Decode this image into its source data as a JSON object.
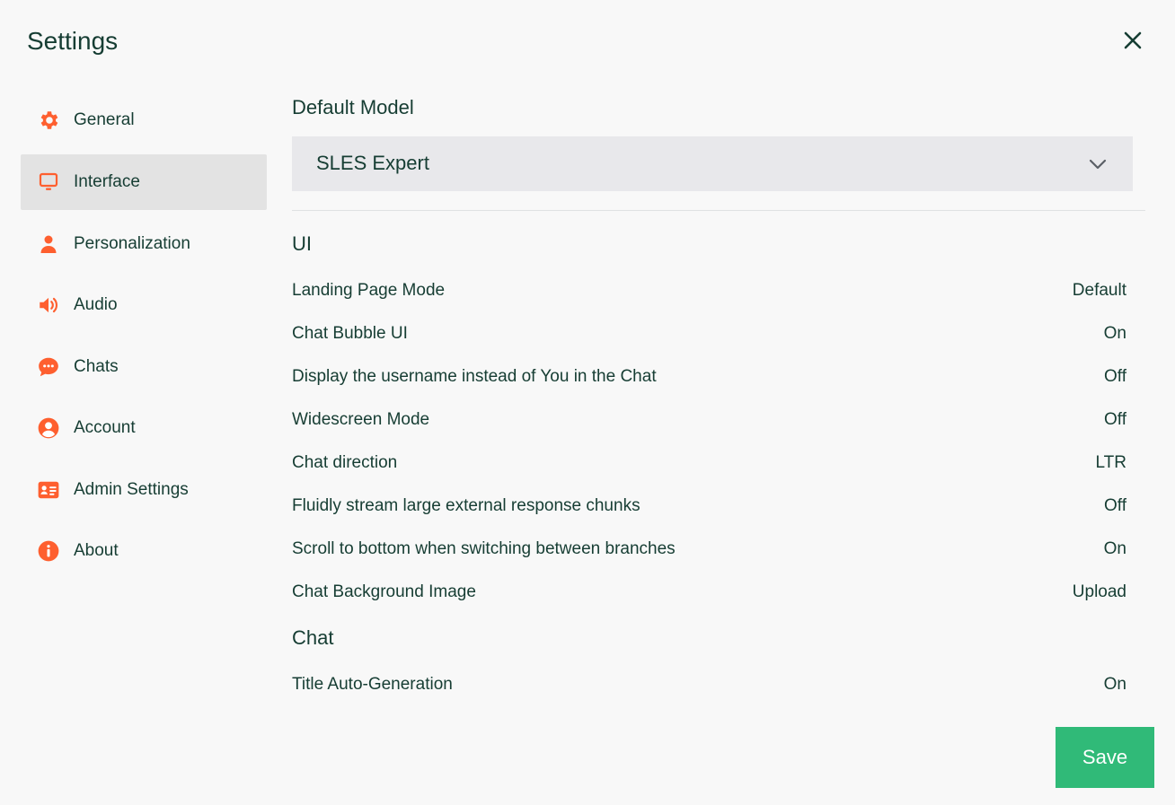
{
  "header": {
    "title": "Settings"
  },
  "colors": {
    "accent": "#fe5f2f",
    "text": "#163d33",
    "save": "#30ba78",
    "active_bg": "#e3e3e3"
  },
  "sidebar": {
    "items": [
      {
        "label": "General",
        "icon": "gear-icon",
        "active": false
      },
      {
        "label": "Interface",
        "icon": "monitor-icon",
        "active": true
      },
      {
        "label": "Personalization",
        "icon": "person-icon",
        "active": false
      },
      {
        "label": "Audio",
        "icon": "speaker-icon",
        "active": false
      },
      {
        "label": "Chats",
        "icon": "chat-bubble-icon",
        "active": false
      },
      {
        "label": "Account",
        "icon": "user-circle-icon",
        "active": false
      },
      {
        "label": "Admin Settings",
        "icon": "id-card-icon",
        "active": false
      },
      {
        "label": "About",
        "icon": "info-icon",
        "active": false
      }
    ]
  },
  "main": {
    "default_model": {
      "heading": "Default Model",
      "selected": "SLES Expert"
    },
    "ui_section": {
      "heading": "UI",
      "rows": [
        {
          "label": "Landing Page Mode",
          "value": "Default"
        },
        {
          "label": "Chat Bubble UI",
          "value": "On"
        },
        {
          "label": "Display the username instead of You in the Chat",
          "value": "Off"
        },
        {
          "label": "Widescreen Mode",
          "value": "Off"
        },
        {
          "label": "Chat direction",
          "value": "LTR"
        },
        {
          "label": "Fluidly stream large external response chunks",
          "value": "Off"
        },
        {
          "label": "Scroll to bottom when switching between branches",
          "value": "On"
        },
        {
          "label": "Chat Background Image",
          "value": "Upload"
        }
      ]
    },
    "chat_section": {
      "heading": "Chat",
      "rows": [
        {
          "label": "Title Auto-Generation",
          "value": "On"
        }
      ]
    }
  },
  "footer": {
    "save_label": "Save"
  }
}
